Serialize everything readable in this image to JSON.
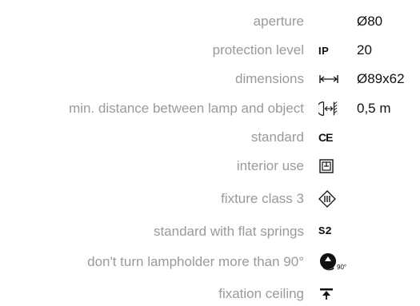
{
  "specs": [
    {
      "label": "aperture",
      "icon": null,
      "value": "Ø80"
    },
    {
      "label": "protection level",
      "icon": "ip-rating-icon",
      "icon_text": "IP",
      "value": "20"
    },
    {
      "label": "dimensions",
      "icon": "dimensions-arrow-icon",
      "value": "Ø89x62"
    },
    {
      "label": "min. distance between lamp and object",
      "icon": "min-distance-icon",
      "value": "0,5 m"
    },
    {
      "label": "standard",
      "icon": "ce-mark-icon",
      "icon_text": "CE",
      "value": ""
    },
    {
      "label": "interior use",
      "icon": "interior-use-icon",
      "value": ""
    },
    {
      "label": "fixture class 3",
      "icon": "class-3-icon",
      "value": ""
    },
    {
      "label": "standard with flat springs",
      "icon": "flat-springs-icon",
      "icon_text": "S2",
      "value": ""
    },
    {
      "label": "don't turn lampholder more than 90°",
      "icon": "rotation-limit-icon",
      "icon_text": "90°",
      "value": ""
    },
    {
      "label": "fixation ceiling",
      "icon": "ceiling-fixation-icon",
      "value": ""
    }
  ],
  "colors": {
    "label": "#9a9a9a",
    "value": "#111111",
    "icon": "#111111"
  }
}
